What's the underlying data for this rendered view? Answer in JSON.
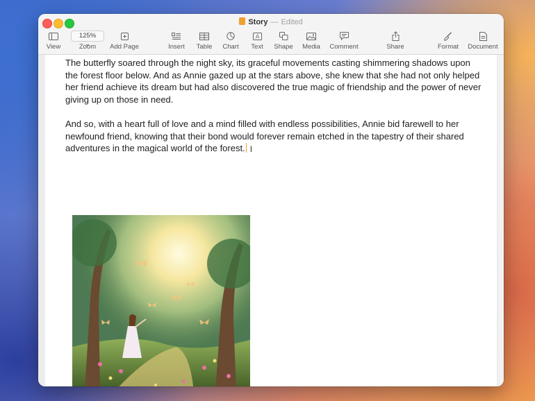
{
  "window": {
    "title": "Story",
    "status": "Edited"
  },
  "toolbar": {
    "view": "View",
    "zoom_value": "125%",
    "zoom": "Zoom",
    "add_page": "Add Page",
    "insert": "Insert",
    "table": "Table",
    "chart": "Chart",
    "text": "Text",
    "shape": "Shape",
    "media": "Media",
    "comment": "Comment",
    "share": "Share",
    "format": "Format",
    "document": "Document"
  },
  "document": {
    "paragraphs": [
      "The butterfly soared through the night sky, its graceful movements casting shimmering shadows upon the forest floor below. And as Annie gazed up at the stars above, she knew that she had not only helped her friend achieve its dream but had also discovered the true magic of friendship and the power of never giving up on those in need.",
      "And so, with a heart full of love and a mind filled with endless possibilities, Annie bid farewell to her newfound friend, knowing that their bond would forever remain etched in the tapestry of their shared adventures in the magical world of the forest."
    ]
  },
  "colors": {
    "accent": "#f0a020",
    "close": "#ff5f57",
    "minimize": "#febc2e",
    "maximize": "#28c840"
  }
}
